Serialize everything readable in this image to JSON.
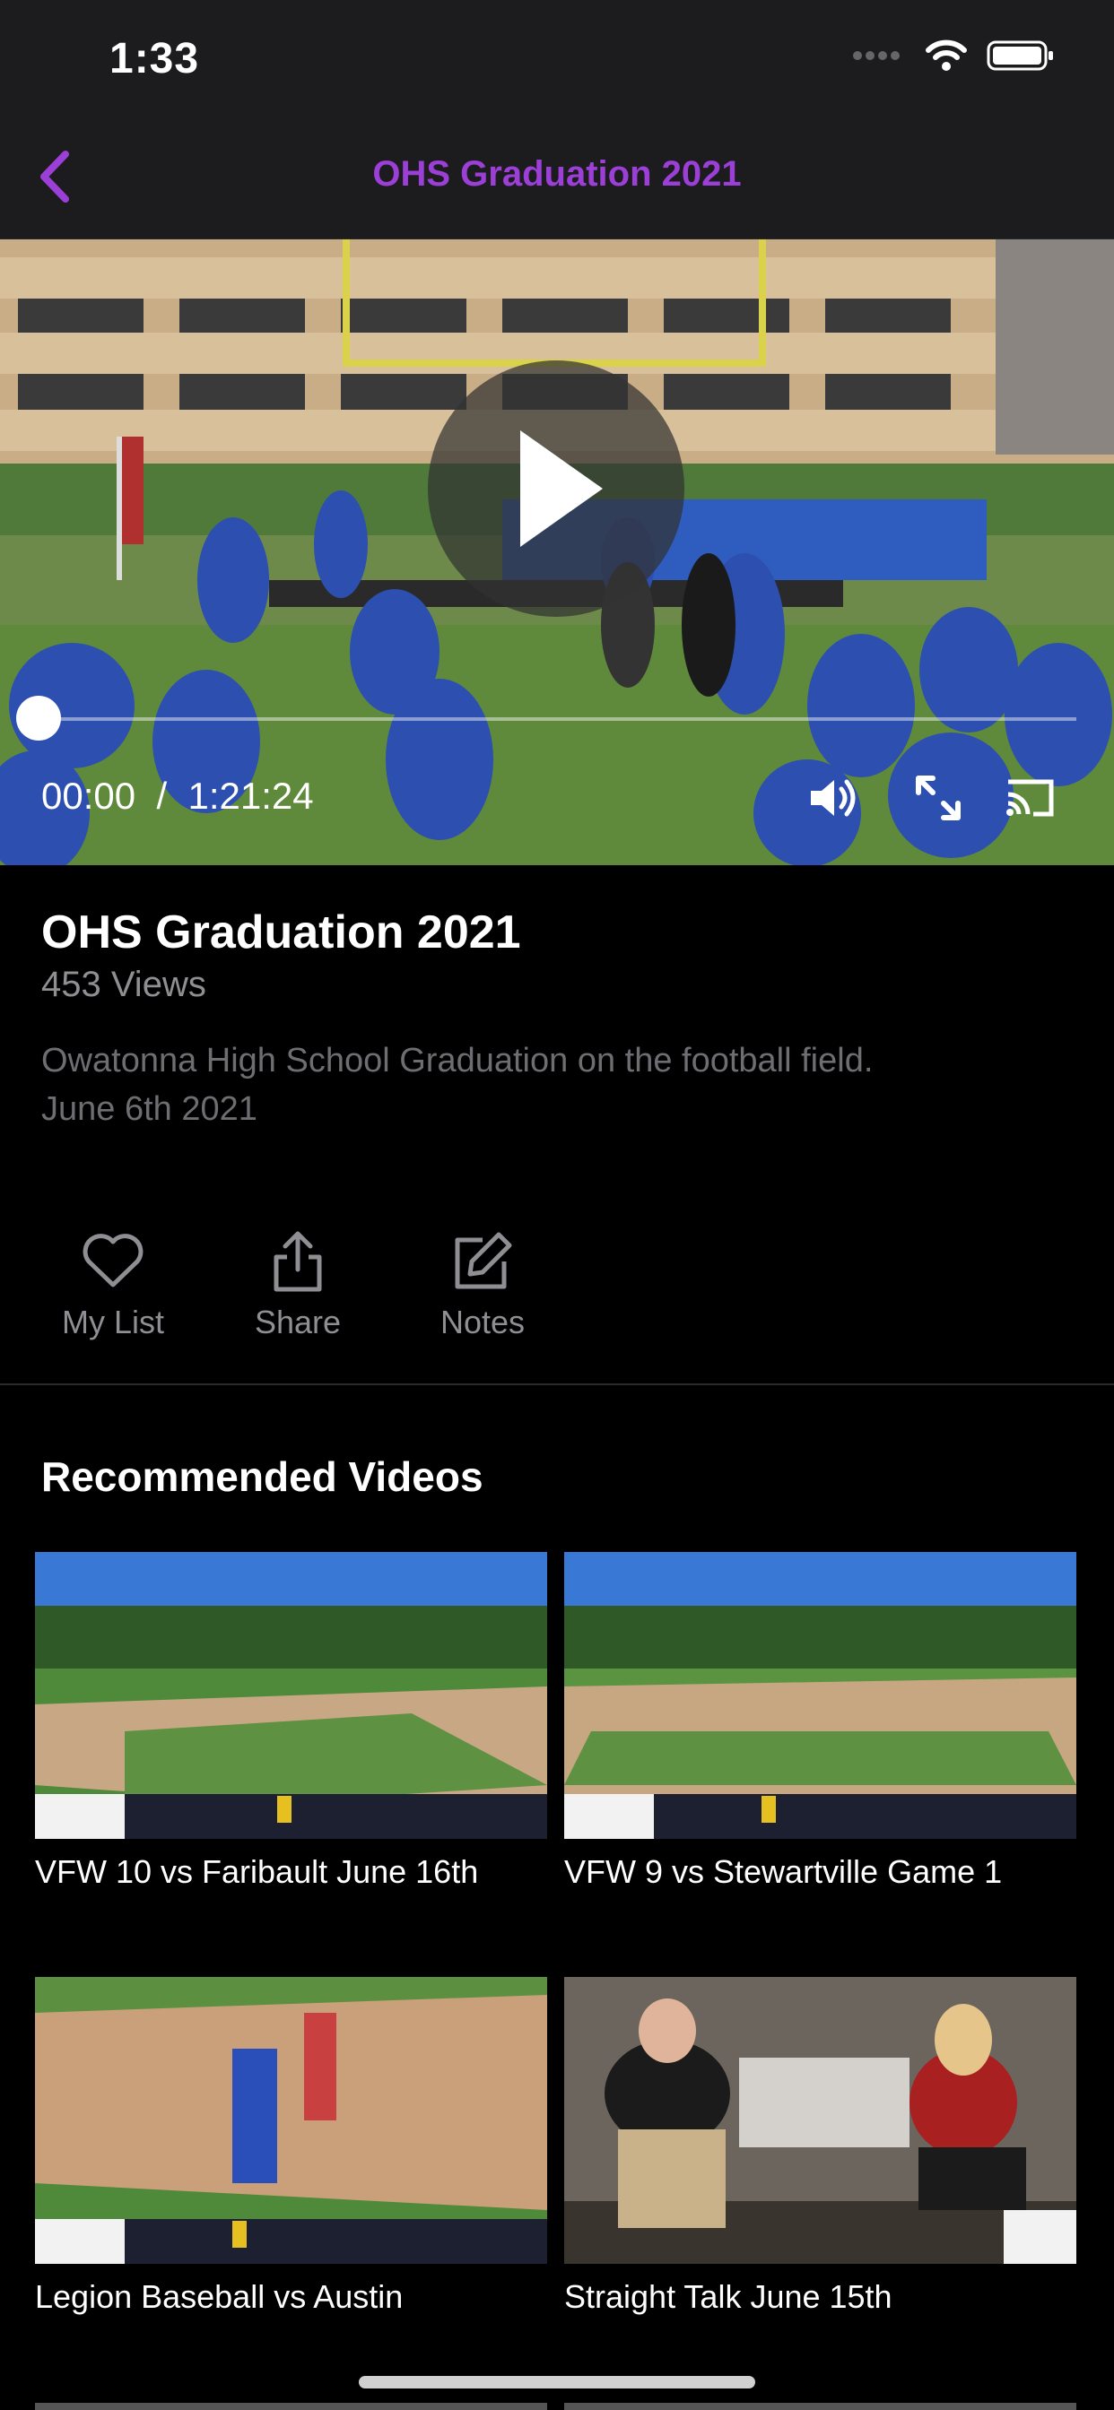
{
  "status_bar": {
    "time": "1:33"
  },
  "nav": {
    "title": "OHS Graduation 2021",
    "accent": "#9b3fd6"
  },
  "player": {
    "current_time": "00:00",
    "separator": "/",
    "duration": "1:21:24",
    "progress": 0
  },
  "video": {
    "title": "OHS Graduation 2021",
    "views": "453 Views",
    "description_line1": "Owatonna High School Graduation on the football field.",
    "description_line2": "June 6th 2021"
  },
  "actions": [
    {
      "label": "My List",
      "icon": "heart-icon"
    },
    {
      "label": "Share",
      "icon": "share-icon"
    },
    {
      "label": "Notes",
      "icon": "edit-icon"
    }
  ],
  "recommended": {
    "heading": "Recommended Videos",
    "items": [
      {
        "title": "VFW 10 vs Faribault June 16th"
      },
      {
        "title": "VFW 9 vs Stewartville Game 1"
      },
      {
        "title": "Legion Baseball vs Austin"
      },
      {
        "title": "Straight Talk June 15th"
      }
    ]
  }
}
